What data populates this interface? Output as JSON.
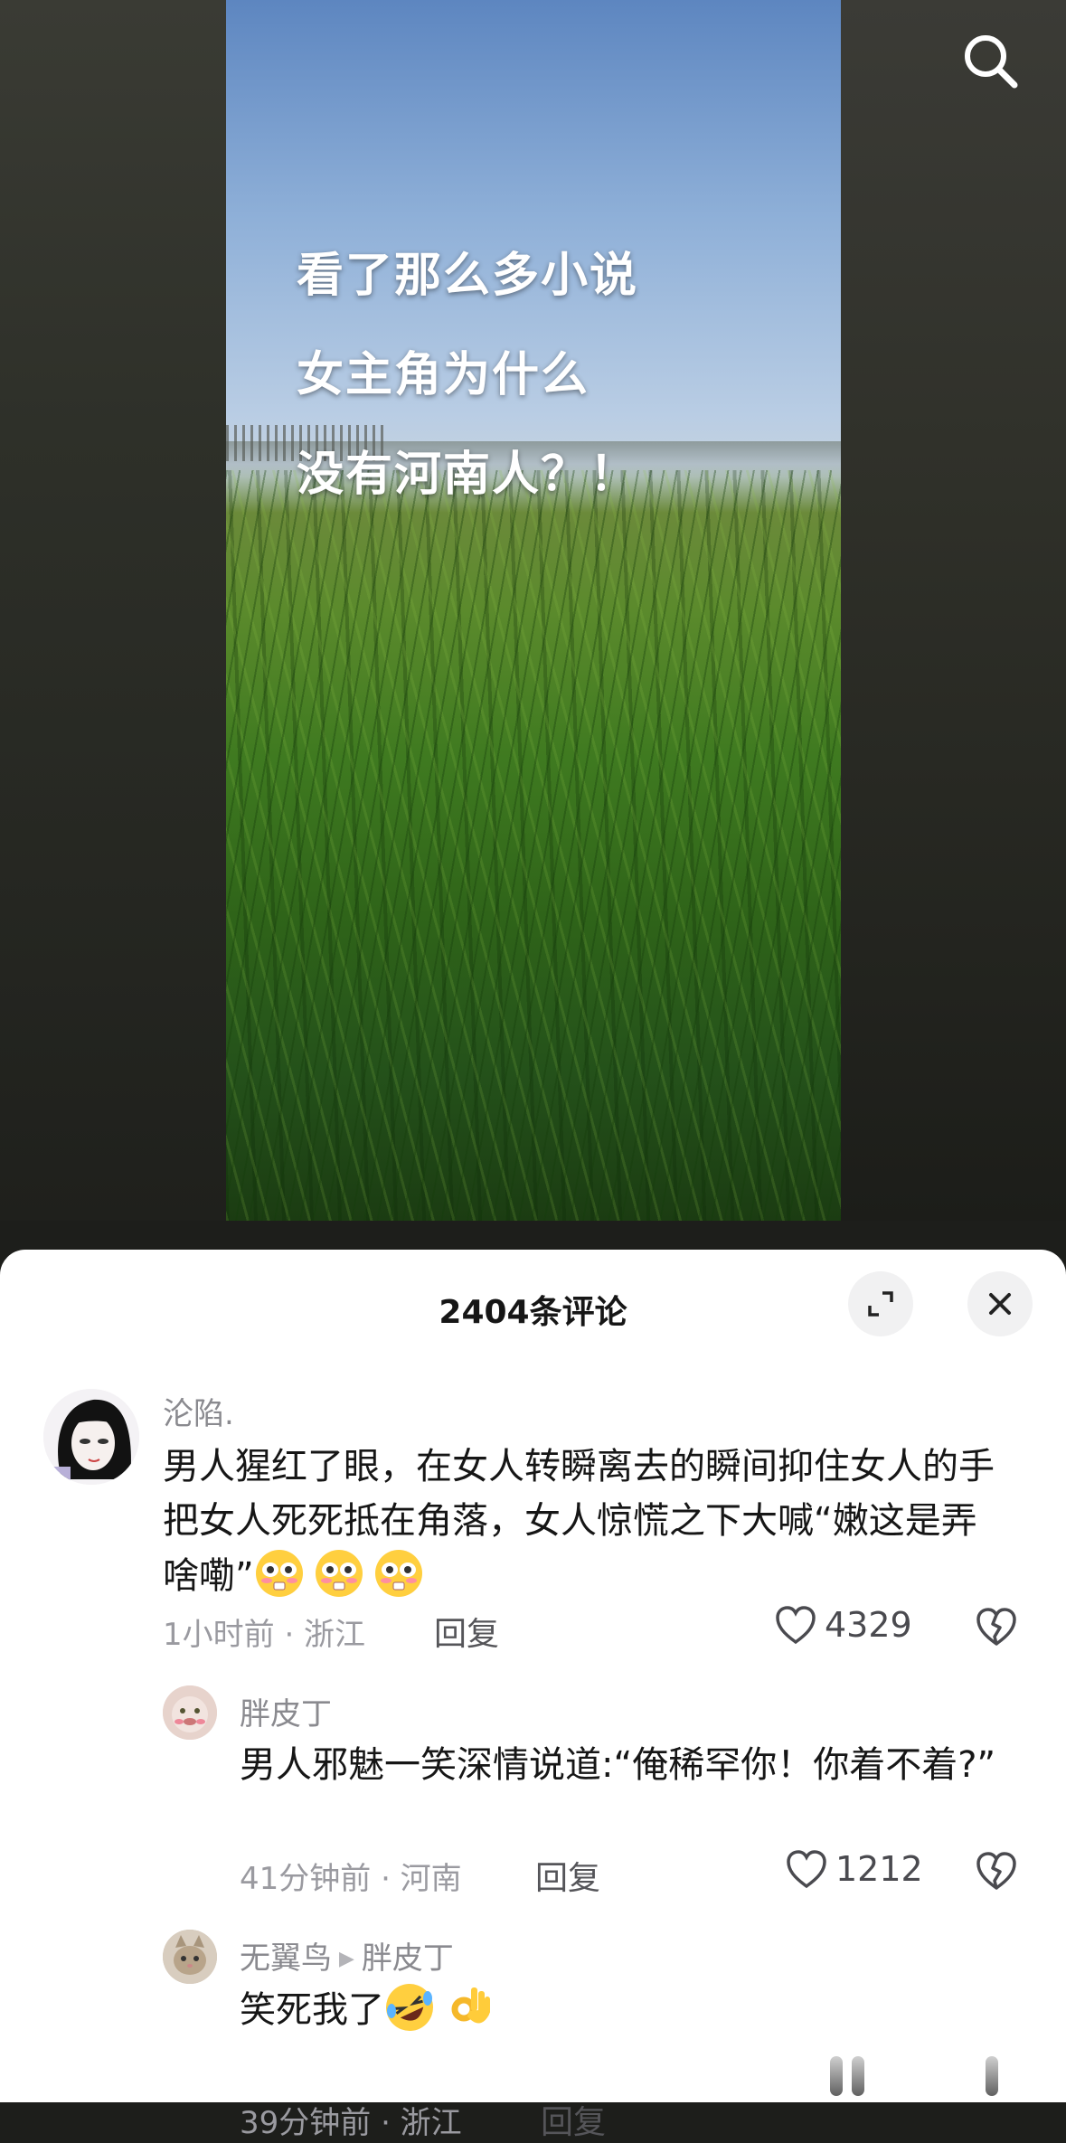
{
  "video": {
    "overlay_lines": [
      "看了那么多小说",
      "女主角为什么",
      "没有河南人？！"
    ]
  },
  "top_bar": {
    "search_icon": "search-icon"
  },
  "comments_panel": {
    "title": "2404条评论",
    "expand_icon": "expand-icon",
    "close_icon": "close-icon",
    "comments": [
      {
        "username": "沦陷.",
        "text": "男人猩红了眼，在女人转瞬离去的瞬间抑住女人的手把女人死死抵在角落，女人惊慌之下大喊“嫩这是弄啥嘞”",
        "emojis": [
          "embarrassed-face-icon",
          "embarrassed-face-icon",
          "embarrassed-face-icon"
        ],
        "time_location": "1小时前 · 浙江",
        "reply_label": "回复",
        "likes": "4329"
      },
      {
        "username": "胖皮丁",
        "text": "男人邪魅一笑深情说道:“俺稀罕你！你着不着?”",
        "time_location": "41分钟前 · 河南",
        "reply_label": "回复",
        "likes": "1212"
      },
      {
        "username": "无翼鸟",
        "reply_to": "胖皮丁",
        "text": "笑死我了",
        "emojis": [
          "rolling-laughing-icon",
          "ok-hand-icon"
        ],
        "time_location": "39分钟前 · 浙江",
        "reply_label": "回复"
      }
    ]
  },
  "colors": {
    "sheet_bg": "#ffffff",
    "text_primary": "#161616",
    "text_secondary": "#8a8a8f",
    "button_bg": "#f1f1f2"
  }
}
